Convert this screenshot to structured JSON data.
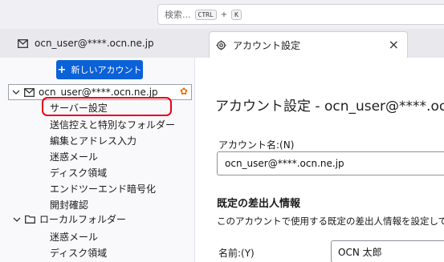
{
  "search": {
    "placeholder": "検索...",
    "key1": "CTRL",
    "plus": "+",
    "key2": "K"
  },
  "tabs": [
    {
      "label": "ocn_user@****.ocn.ne.jp",
      "icon": "mail-icon"
    },
    {
      "label": "アカウント設定",
      "icon": "gear-icon",
      "close": "×"
    }
  ],
  "sidebar": {
    "new_account": "新しいアカウント",
    "account": "ocn_user@****.ocn.ne.jp",
    "account_items": [
      "サーバー設定",
      "送信控えと特別なフォルダー",
      "編集とアドレス入力",
      "迷惑メール",
      "ディスク領域",
      "エンドツーエンド暗号化",
      "開封確認"
    ],
    "local_folders": "ローカルフォルダー",
    "local_items": [
      "迷惑メール",
      "ディスク領域"
    ]
  },
  "main": {
    "title": "アカウント設定 - ocn_user@****.ocn.",
    "account_name_label": "アカウント名:(N)",
    "account_name_value": "ocn_user@****.ocn.ne.jp",
    "identity_heading": "既定の差出人情報",
    "identity_desc": "このアカウントで使用する既定の差出人情報を設定して",
    "name_label": "名前:(Y)",
    "name_value": "OCN 太郎"
  },
  "colors": {
    "accent": "#0b61d8",
    "highlight_ring": "#e8001a",
    "star": "#e07010"
  }
}
